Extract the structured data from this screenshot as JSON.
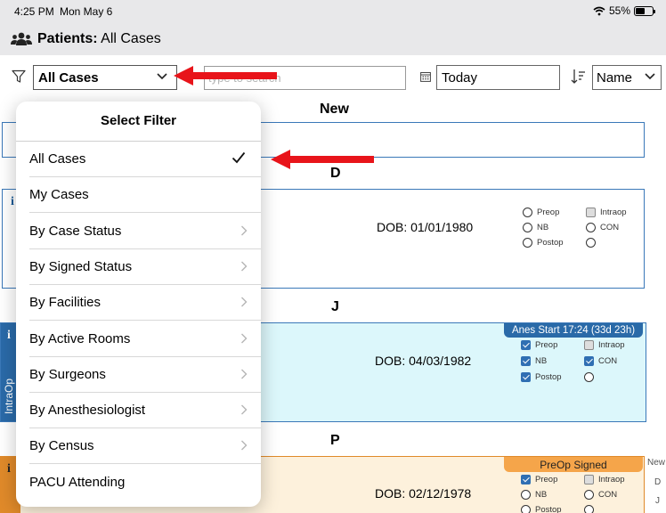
{
  "status_bar": {
    "time": "4:25 PM",
    "date": "Mon May 6",
    "battery": "55%",
    "battery_level": 0.55
  },
  "header": {
    "title_bold": "Patients:",
    "title_rest": "All Cases",
    "icon": "users-icon"
  },
  "toolbar": {
    "filter_value": "All Cases",
    "search_placeholder": "type to search",
    "date_value": "Today",
    "sort_value": "Name"
  },
  "groups": {
    "new": "New",
    "d": "D",
    "j": "J",
    "p": "P"
  },
  "cards": {
    "d": {
      "info": "i",
      "dob": "DOB: 01/01/1980",
      "checks": {
        "preop": "Preop",
        "intraop": "Intraop",
        "nb": "NB",
        "con": "CON",
        "postop": "Postop"
      }
    },
    "j": {
      "info": "i",
      "dob": "DOB: 04/03/1982",
      "stripe_label": "IntraOp",
      "badge": "Anes Start 17:24 (33d 23h)",
      "checks": {
        "preop": "Preop",
        "intraop": "Intraop",
        "nb": "NB",
        "con": "CON",
        "postop": "Postop"
      }
    },
    "p": {
      "info": "i",
      "dob": "DOB: 02/12/1978",
      "badge": "PreOp Signed",
      "checks": {
        "preop": "Preop",
        "intraop": "Intraop",
        "nb": "NB",
        "con": "CON",
        "postop": "Postop"
      }
    }
  },
  "index": [
    "New",
    "D",
    "J"
  ],
  "popover": {
    "title": "Select Filter",
    "items": [
      {
        "label": "All Cases",
        "selected": true
      },
      {
        "label": "My Cases"
      },
      {
        "label": "By Case Status"
      },
      {
        "label": "By Signed Status"
      },
      {
        "label": "By Facilities"
      },
      {
        "label": "By Active Rooms"
      },
      {
        "label": "By Surgeons"
      },
      {
        "label": "By Anesthesiologist"
      },
      {
        "label": "By Census"
      },
      {
        "label": "PACU Attending"
      }
    ]
  },
  "colors": {
    "accent": "#2f6fb3",
    "intraop_bg": "#dcf7fb",
    "intraop_stripe": "#2a6aa8",
    "preop_bg": "#fdf1dc",
    "preop_stripe": "#e08a2a",
    "badge_orange": "#f5a54a",
    "arrow_red": "#e8141a"
  }
}
